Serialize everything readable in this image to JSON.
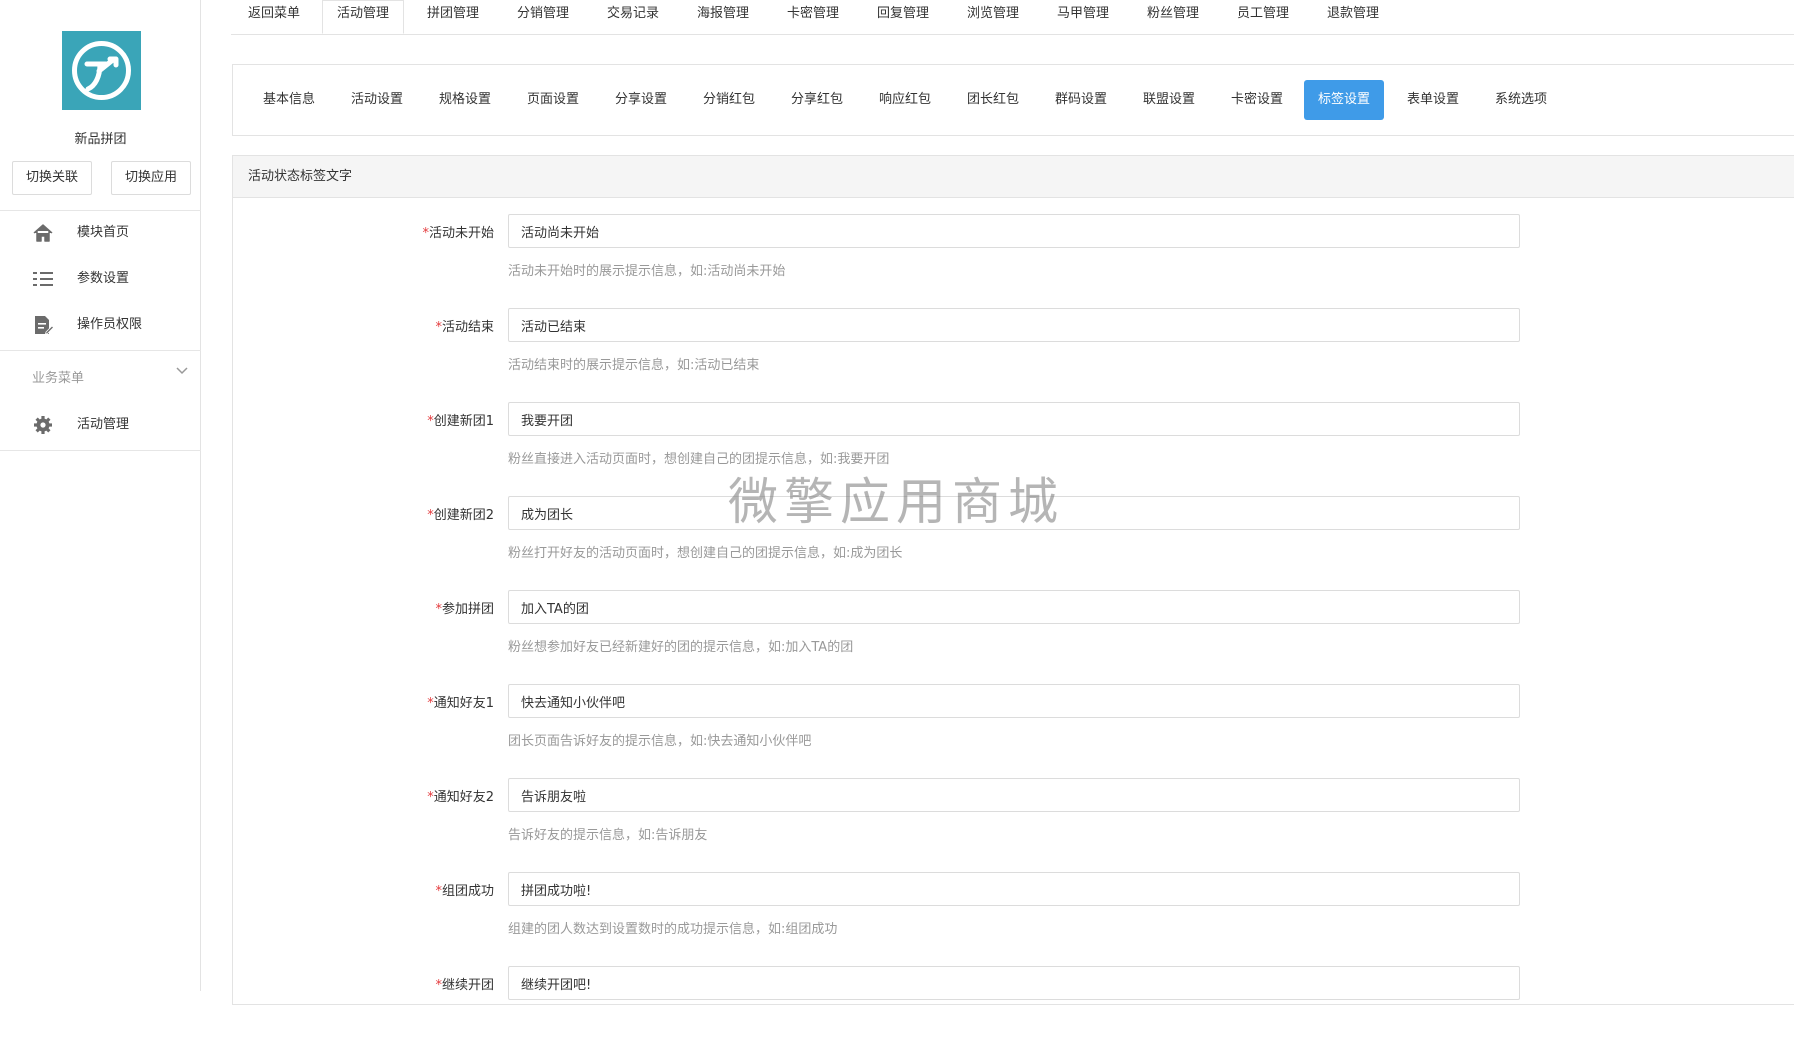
{
  "sidebar": {
    "app_name": "新品拼团",
    "switch_link_label": "切换关联",
    "switch_app_label": "切换应用",
    "nav": [
      {
        "label": "模块首页",
        "icon": "home-icon"
      },
      {
        "label": "参数设置",
        "icon": "list-icon"
      },
      {
        "label": "操作员权限",
        "icon": "document-edit-icon"
      }
    ],
    "section_title": "业务菜单",
    "section_items": [
      {
        "label": "活动管理",
        "icon": "gear-icon"
      }
    ]
  },
  "top_tabs": [
    {
      "label": "返回菜单"
    },
    {
      "label": "活动管理",
      "active": true
    },
    {
      "label": "拼团管理"
    },
    {
      "label": "分销管理"
    },
    {
      "label": "交易记录"
    },
    {
      "label": "海报管理"
    },
    {
      "label": "卡密管理"
    },
    {
      "label": "回复管理"
    },
    {
      "label": "浏览管理"
    },
    {
      "label": "马甲管理"
    },
    {
      "label": "粉丝管理"
    },
    {
      "label": "员工管理"
    },
    {
      "label": "退款管理"
    }
  ],
  "sub_tabs": [
    {
      "label": "基本信息"
    },
    {
      "label": "活动设置"
    },
    {
      "label": "规格设置"
    },
    {
      "label": "页面设置"
    },
    {
      "label": "分享设置"
    },
    {
      "label": "分销红包"
    },
    {
      "label": "分享红包"
    },
    {
      "label": "响应红包"
    },
    {
      "label": "团长红包"
    },
    {
      "label": "群码设置"
    },
    {
      "label": "联盟设置"
    },
    {
      "label": "卡密设置"
    },
    {
      "label": "标签设置",
      "active": true
    },
    {
      "label": "表单设置"
    },
    {
      "label": "系统选项"
    }
  ],
  "panel": {
    "title": "活动状态标签文字",
    "fields": [
      {
        "required_mark": "*",
        "label": "活动未开始",
        "value": "活动尚未开始",
        "help": "活动未开始时的展示提示信息，如:活动尚未开始"
      },
      {
        "required_mark": "*",
        "label": "活动结束",
        "value": "活动已结束",
        "help": "活动结束时的展示提示信息，如:活动已结束"
      },
      {
        "required_mark": "*",
        "label": "创建新团1",
        "value": "我要开团",
        "help": "粉丝直接进入活动页面时，想创建自己的团提示信息，如:我要开团"
      },
      {
        "required_mark": "*",
        "label": "创建新团2",
        "value": "成为团长",
        "help": "粉丝打开好友的活动页面时，想创建自己的团提示信息，如:成为团长"
      },
      {
        "required_mark": "*",
        "label": "参加拼团",
        "value": "加入TA的团",
        "help": "粉丝想参加好友已经新建好的团的提示信息，如:加入TA的团"
      },
      {
        "required_mark": "*",
        "label": "通知好友1",
        "value": "快去通知小伙伴吧",
        "help": "团长页面告诉好友的提示信息，如:快去通知小伙伴吧"
      },
      {
        "required_mark": "*",
        "label": "通知好友2",
        "value": "告诉朋友啦",
        "help": "告诉好友的提示信息，如:告诉朋友"
      },
      {
        "required_mark": "*",
        "label": "组团成功",
        "value": "拼团成功啦!",
        "help": "组建的团人数达到设置数时的成功提示信息，如:组团成功"
      },
      {
        "required_mark": "*",
        "label": "继续开团",
        "value": "继续开团吧!",
        "help": ""
      }
    ]
  },
  "watermark": "微擎应用商城",
  "colors": {
    "accent": "#3f9be8",
    "logo_bg": "#3aa5b8",
    "required": "#e4393c"
  }
}
